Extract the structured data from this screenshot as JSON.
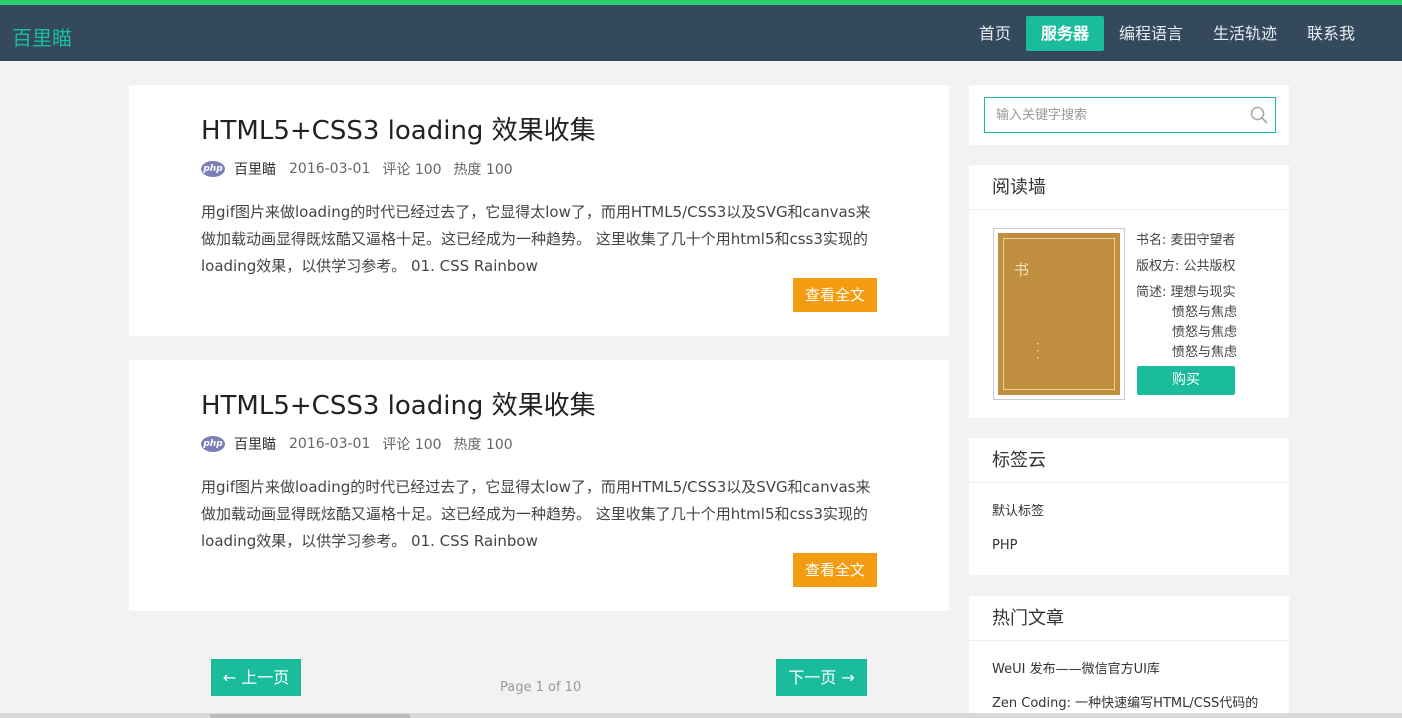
{
  "header": {
    "brand": "百里瞄",
    "nav": [
      {
        "label": "首页",
        "active": false
      },
      {
        "label": "服务器",
        "active": true
      },
      {
        "label": "编程语言",
        "active": false
      },
      {
        "label": "生活轨迹",
        "active": false
      },
      {
        "label": "联系我",
        "active": false
      }
    ]
  },
  "posts": [
    {
      "title": "HTML5+CSS3 loading 效果收集",
      "author_icon": "php",
      "author": "百里瞄",
      "date": "2016-03-01",
      "comments": "评论 100",
      "heat": "热度 100",
      "excerpt": "用gif图片来做loading的时代已经过去了，它显得太low了，而用HTML5/CSS3以及SVG和canvas来做加载动画显得既炫酷又逼格十足。这已经成为一种趋势。 这里收集了几十个用html5和css3实现的loading效果，以供学习参考。 01. CSS Rainbow",
      "read_more": "查看全文"
    },
    {
      "title": "HTML5+CSS3 loading 效果收集",
      "author_icon": "php",
      "author": "百里瞄",
      "date": "2016-03-01",
      "comments": "评论 100",
      "heat": "热度 100",
      "excerpt": "用gif图片来做loading的时代已经过去了，它显得太low了，而用HTML5/CSS3以及SVG和canvas来做加载动画显得既炫酷又逼格十足。这已经成为一种趋势。 这里收集了几十个用html5和css3实现的loading效果，以供学习参考。 01. CSS Rainbow",
      "read_more": "查看全文"
    }
  ],
  "pagination": {
    "prev": "← 上一页",
    "next": "下一页 →",
    "info": "Page 1 of 10"
  },
  "sidebar": {
    "search_placeholder": "输入关键字搜索",
    "reading": {
      "title": "阅读墙",
      "cover_char": "书",
      "book_name": "书名: 麦田守望者",
      "copyright": "版权方: 公共版权",
      "desc_label": "简述: 理想与现实",
      "desc_lines": [
        "愤怒与焦虑",
        "愤怒与焦虑",
        "愤怒与焦虑"
      ],
      "buy": "购买"
    },
    "tags": {
      "title": "标签云",
      "items": [
        "默认标签",
        "PHP"
      ]
    },
    "hot": {
      "title": "热门文章",
      "items": [
        "WeUI 发布——微信官方UI库",
        "Zen Coding: 一种快速编写HTML/CSS代码的"
      ]
    }
  },
  "colors": {
    "accent": "#1abc9c",
    "header_bg": "#34495e",
    "top_stripe": "#2ecc71",
    "read_more": "#f39c12"
  }
}
